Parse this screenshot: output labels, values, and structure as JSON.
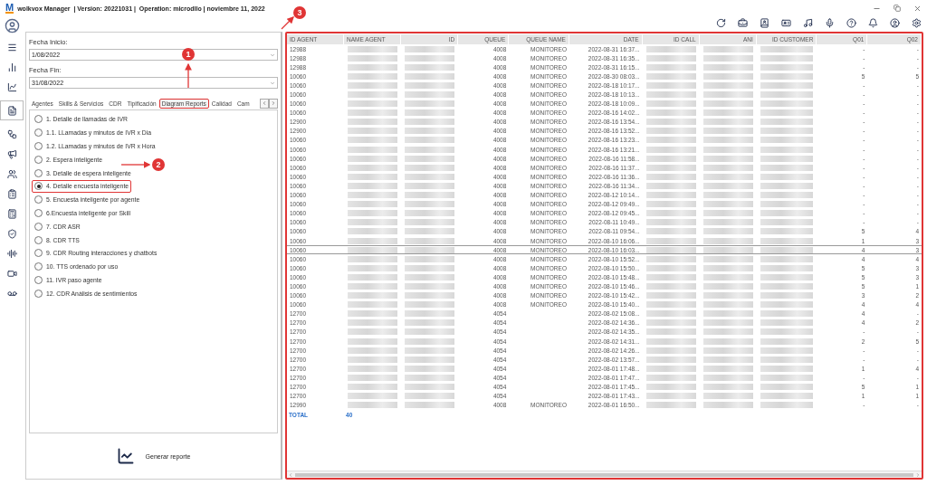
{
  "window": {
    "logo_text": "M",
    "title": "wolkvox Manager  | Version: 20221031 |  Operation: microdllo | noviembre 11, 2022"
  },
  "filters": [
    {
      "label": "Fecha Inicio:",
      "value": "1/08/2022"
    },
    {
      "label": "Fecha Fin:",
      "value": "31/08/2022"
    }
  ],
  "tabs": [
    {
      "label": "Agentes",
      "selected": false
    },
    {
      "label": "Skills & Servicios",
      "selected": false
    },
    {
      "label": "CDR",
      "selected": false
    },
    {
      "label": "Tipificación",
      "selected": false
    },
    {
      "label": "Diagram Reports",
      "selected": true
    },
    {
      "label": "Calidad",
      "selected": false
    },
    {
      "label": "Cam",
      "selected": false
    }
  ],
  "reports": [
    {
      "label": "1. Detalle de llamadas de IVR",
      "selected": false
    },
    {
      "label": "1.1. LLamadas y minutos de IVR x Dia",
      "selected": false
    },
    {
      "label": "1.2. LLamadas y minutos de IVR x Hora",
      "selected": false
    },
    {
      "label": "2. Espera inteligente",
      "selected": false
    },
    {
      "label": "3. Detalle de espera inteligente",
      "selected": false
    },
    {
      "label": "4. Detalle encuesta inteligente",
      "selected": true
    },
    {
      "label": "5. Encuesta inteligente por agente",
      "selected": false
    },
    {
      "label": "6.Encuesta inteligente por Skill",
      "selected": false
    },
    {
      "label": "7. CDR ASR",
      "selected": false
    },
    {
      "label": "8. CDR TTS",
      "selected": false
    },
    {
      "label": "9. CDR Routing interacciones y chatbots",
      "selected": false
    },
    {
      "label": "10. TTS ordenado por uso",
      "selected": false
    },
    {
      "label": "11. IVR paso agente",
      "selected": false
    },
    {
      "label": "12. CDR Análisis de sentimientos",
      "selected": false
    }
  ],
  "generate_button": "Generar reporte",
  "table": {
    "columns": [
      "ID AGENT",
      "NAME AGENT",
      "ID",
      "QUEUE",
      "QUEUE NAME",
      "DATE",
      "ID CALL",
      "ANI",
      "ID CUSTOMER",
      "Q01",
      "Q02"
    ],
    "rows": [
      {
        "id_agent": "12988",
        "queue": "4008",
        "queue_name": "MONITOREO",
        "date": "2022-08-31 16:37...",
        "q01": "-",
        "q02": "-",
        "selected": false
      },
      {
        "id_agent": "12988",
        "queue": "4008",
        "queue_name": "MONITOREO",
        "date": "2022-08-31 16:35...",
        "q01": "-",
        "q02": "-",
        "selected": false
      },
      {
        "id_agent": "12988",
        "queue": "4008",
        "queue_name": "MONITOREO",
        "date": "2022-08-31 16:15...",
        "q01": "-",
        "q02": "-",
        "selected": false
      },
      {
        "id_agent": "10060",
        "queue": "4008",
        "queue_name": "MONITOREO",
        "date": "2022-08-30 08:03...",
        "q01": "5",
        "q02": "5",
        "selected": false
      },
      {
        "id_agent": "10060",
        "queue": "4008",
        "queue_name": "MONITOREO",
        "date": "2022-08-18 10:17...",
        "q01": "-",
        "q02": "-",
        "selected": false
      },
      {
        "id_agent": "10060",
        "queue": "4008",
        "queue_name": "MONITOREO",
        "date": "2022-08-18 10:13...",
        "q01": "-",
        "q02": "-",
        "selected": false
      },
      {
        "id_agent": "10060",
        "queue": "4008",
        "queue_name": "MONITOREO",
        "date": "2022-08-18 10:09...",
        "q01": "-",
        "q02": "-",
        "selected": false
      },
      {
        "id_agent": "10060",
        "queue": "4008",
        "queue_name": "MONITOREO",
        "date": "2022-08-16 14:02...",
        "q01": "-",
        "q02": "-",
        "selected": false
      },
      {
        "id_agent": "12900",
        "queue": "4008",
        "queue_name": "MONITOREO",
        "date": "2022-08-16 13:54...",
        "q01": "-",
        "q02": "-",
        "selected": false
      },
      {
        "id_agent": "12900",
        "queue": "4008",
        "queue_name": "MONITOREO",
        "date": "2022-08-16 13:52...",
        "q01": "-",
        "q02": "-",
        "selected": false
      },
      {
        "id_agent": "10060",
        "queue": "4008",
        "queue_name": "MONITOREO",
        "date": "2022-08-16 13:23...",
        "q01": "-",
        "q02": "-",
        "selected": false
      },
      {
        "id_agent": "10060",
        "queue": "4008",
        "queue_name": "MONITOREO",
        "date": "2022-08-16 13:21...",
        "q01": "-",
        "q02": "-",
        "selected": false
      },
      {
        "id_agent": "10060",
        "queue": "4008",
        "queue_name": "MONITOREO",
        "date": "2022-08-16 11:58...",
        "q01": "-",
        "q02": "-",
        "selected": false
      },
      {
        "id_agent": "10060",
        "queue": "4008",
        "queue_name": "MONITOREO",
        "date": "2022-08-16 11:37...",
        "q01": "-",
        "q02": "-",
        "selected": false
      },
      {
        "id_agent": "10060",
        "queue": "4008",
        "queue_name": "MONITOREO",
        "date": "2022-08-16 11:36...",
        "q01": "-",
        "q02": "-",
        "selected": false
      },
      {
        "id_agent": "10060",
        "queue": "4008",
        "queue_name": "MONITOREO",
        "date": "2022-08-16 11:34...",
        "q01": "-",
        "q02": "-",
        "selected": false
      },
      {
        "id_agent": "10060",
        "queue": "4008",
        "queue_name": "MONITOREO",
        "date": "2022-08-12 10:14...",
        "q01": "-",
        "q02": "-",
        "selected": false
      },
      {
        "id_agent": "10060",
        "queue": "4008",
        "queue_name": "MONITOREO",
        "date": "2022-08-12 09:49...",
        "q01": "-",
        "q02": "-",
        "selected": false
      },
      {
        "id_agent": "10060",
        "queue": "4008",
        "queue_name": "MONITOREO",
        "date": "2022-08-12 09:45...",
        "q01": "-",
        "q02": "-",
        "selected": false
      },
      {
        "id_agent": "10060",
        "queue": "4008",
        "queue_name": "MONITOREO",
        "date": "2022-08-11 10:49...",
        "q01": "-",
        "q02": "-",
        "selected": false
      },
      {
        "id_agent": "10060",
        "queue": "4008",
        "queue_name": "MONITOREO",
        "date": "2022-08-11 09:54...",
        "q01": "5",
        "q02": "4",
        "selected": false
      },
      {
        "id_agent": "10060",
        "queue": "4008",
        "queue_name": "MONITOREO",
        "date": "2022-08-10 16:06...",
        "q01": "1",
        "q02": "3",
        "selected": false
      },
      {
        "id_agent": "10060",
        "queue": "4008",
        "queue_name": "MONITOREO",
        "date": "2022-08-10 16:03...",
        "q01": "4",
        "q02": "3",
        "selected": true
      },
      {
        "id_agent": "10060",
        "queue": "4008",
        "queue_name": "MONITOREO",
        "date": "2022-08-10 15:52...",
        "q01": "4",
        "q02": "4",
        "selected": false
      },
      {
        "id_agent": "10060",
        "queue": "4008",
        "queue_name": "MONITOREO",
        "date": "2022-08-10 15:50...",
        "q01": "5",
        "q02": "3",
        "selected": false
      },
      {
        "id_agent": "10060",
        "queue": "4008",
        "queue_name": "MONITOREO",
        "date": "2022-08-10 15:48...",
        "q01": "5",
        "q02": "3",
        "selected": false
      },
      {
        "id_agent": "10060",
        "queue": "4008",
        "queue_name": "MONITOREO",
        "date": "2022-08-10 15:46...",
        "q01": "5",
        "q02": "1",
        "selected": false
      },
      {
        "id_agent": "10060",
        "queue": "4008",
        "queue_name": "MONITOREO",
        "date": "2022-08-10 15:42...",
        "q01": "3",
        "q02": "2",
        "selected": false
      },
      {
        "id_agent": "10060",
        "queue": "4008",
        "queue_name": "MONITOREO",
        "date": "2022-08-10 15:40...",
        "q01": "4",
        "q02": "4",
        "selected": false
      },
      {
        "id_agent": "12700",
        "queue": "4054",
        "date": "2022-08-02 15:08...",
        "q01": "4",
        "q02": "-",
        "selected": false
      },
      {
        "id_agent": "12700",
        "queue": "4054",
        "date": "2022-08-02 14:36...",
        "q01": "4",
        "q02": "2",
        "selected": false
      },
      {
        "id_agent": "12700",
        "queue": "4054",
        "date": "2022-08-02 14:35...",
        "q01": "-",
        "q02": "-",
        "selected": false
      },
      {
        "id_agent": "12700",
        "queue": "4054",
        "date": "2022-08-02 14:31...",
        "q01": "2",
        "q02": "5",
        "selected": false
      },
      {
        "id_agent": "12700",
        "queue": "4054",
        "date": "2022-08-02 14:26...",
        "q01": "-",
        "q02": "-",
        "selected": false
      },
      {
        "id_agent": "12700",
        "queue": "4054",
        "date": "2022-08-02 13:57...",
        "q01": "-",
        "q02": "-",
        "selected": false
      },
      {
        "id_agent": "12700",
        "queue": "4054",
        "date": "2022-08-01 17:48...",
        "q01": "1",
        "q02": "4",
        "selected": false
      },
      {
        "id_agent": "12700",
        "queue": "4054",
        "date": "2022-08-01 17:47...",
        "q01": "-",
        "q02": "-",
        "selected": false
      },
      {
        "id_agent": "12700",
        "queue": "4054",
        "date": "2022-08-01 17:45...",
        "q01": "5",
        "q02": "1",
        "selected": false
      },
      {
        "id_agent": "12700",
        "queue": "4054",
        "date": "2022-08-01 17:43...",
        "q01": "1",
        "q02": "1",
        "selected": false
      },
      {
        "id_agent": "12990",
        "queue": "4008",
        "queue_name": "MONITOREO",
        "date": "2022-08-01 16:50...",
        "q01": "-",
        "q02": "-",
        "selected": false
      }
    ],
    "total": {
      "label": "TOTAL",
      "value": "40"
    }
  },
  "callouts": [
    {
      "number": "1"
    },
    {
      "number": "2"
    },
    {
      "number": "3"
    }
  ]
}
